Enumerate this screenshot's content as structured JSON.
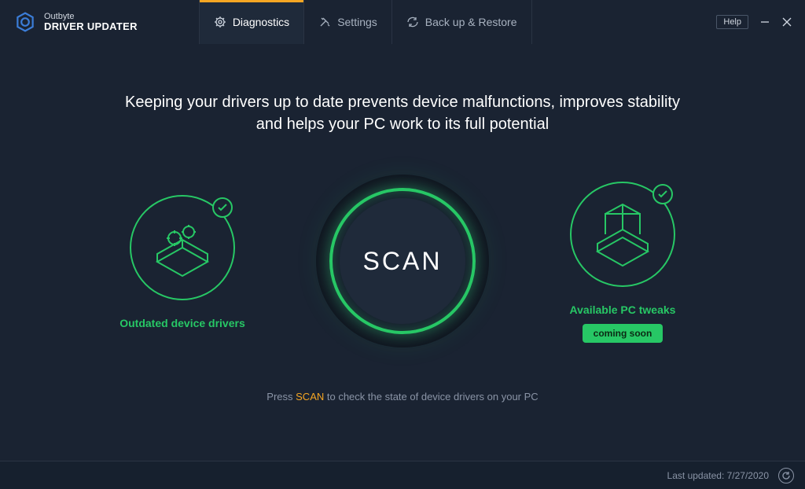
{
  "brand": {
    "company": "Outbyte",
    "product": "DRIVER UPDATER"
  },
  "tabs": {
    "diagnostics": "Diagnostics",
    "settings": "Settings",
    "backup": "Back up & Restore"
  },
  "window": {
    "help": "Help"
  },
  "headline_line1": "Keeping your drivers up to date prevents device malfunctions, improves stability",
  "headline_line2": "and helps your PC work to its full potential",
  "cards": {
    "outdated": "Outdated device drivers",
    "tweaks": "Available PC tweaks",
    "coming_soon": "coming soon"
  },
  "scan": {
    "label": "SCAN"
  },
  "hint": {
    "prefix": "Press ",
    "accent": "SCAN",
    "suffix": " to check the state of device drivers on your PC"
  },
  "footer": {
    "last_updated_label": "Last updated: ",
    "last_updated_value": "7/27/2020"
  }
}
